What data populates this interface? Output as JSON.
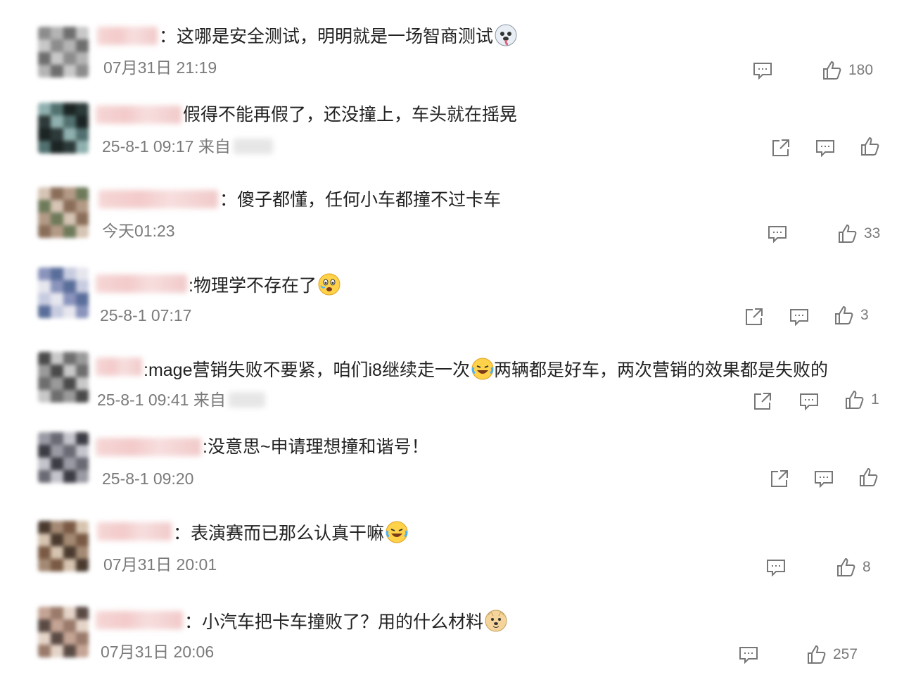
{
  "comments": [
    {
      "text": "：这哪是安全测试，明明就是一场智商测试",
      "emoji": "husky-emoji",
      "meta": "07月31日 21:19",
      "show_share": false,
      "like_count": "180",
      "avatar_colors": [
        "#8c8c8c",
        "#b4b4b4",
        "#6e6e6e",
        "#c8c8c8"
      ]
    },
    {
      "text": "假得不能再假了，还没撞上，车头就在摇晃",
      "emoji": "",
      "meta": "25-8-1 09:17 来自",
      "show_share": true,
      "like_count": "",
      "avatar_colors": [
        "#2d3a3a",
        "#8fb0ae",
        "#51706f",
        "#1c2424"
      ]
    },
    {
      "text": "：傻子都懂，任何小车都撞不过卡车",
      "emoji": "",
      "meta": "今天01:23",
      "show_share": false,
      "like_count": "33",
      "avatar_colors": [
        "#b39a86",
        "#6e7a5a",
        "#d6c4b4",
        "#8a6e5a"
      ]
    },
    {
      "text": ":物理学不存在了",
      "emoji": "scared-emoji",
      "meta": "25-8-1 07:17",
      "show_share": true,
      "like_count": "3",
      "avatar_colors": [
        "#5a6e9a",
        "#c8cce0",
        "#e6e6ee",
        "#8a94bc"
      ]
    },
    {
      "text": ":mage营销失败不要紧，咱们i8继续走一次",
      "text2": "两辆都是好车，两次营销的效果都是失败的",
      "emoji": "laugh-cry-emoji",
      "meta": "25-8-1 09:41 来自",
      "show_share": true,
      "like_count": "1",
      "avatar_colors": [
        "#4a4a4a",
        "#c8c8c8",
        "#6e6e6e",
        "#9a9a9a"
      ]
    },
    {
      "text": ":没意思~申请理想撞和谐号！",
      "emoji": "",
      "meta": "25-8-1 09:20",
      "show_share": true,
      "like_count": "",
      "avatar_colors": [
        "#3c3c44",
        "#9a9aa4",
        "#6a6a74",
        "#c4c4cc"
      ]
    },
    {
      "text": "：表演赛而已那么认真干嘛",
      "emoji": "laugh-cry-emoji",
      "meta": "07月31日 20:01",
      "show_share": false,
      "like_count": "8",
      "avatar_colors": [
        "#7a5a44",
        "#d6c4b0",
        "#4a3a2e",
        "#a48a74"
      ]
    },
    {
      "text": "：小汽车把卡车撞败了？用的什么材料",
      "emoji": "doge-emoji",
      "meta": "07月31日 20:06",
      "show_share": false,
      "like_count": "257",
      "avatar_colors": [
        "#9a7a6a",
        "#e4d4c8",
        "#5a4a44",
        "#c4a494"
      ]
    }
  ]
}
